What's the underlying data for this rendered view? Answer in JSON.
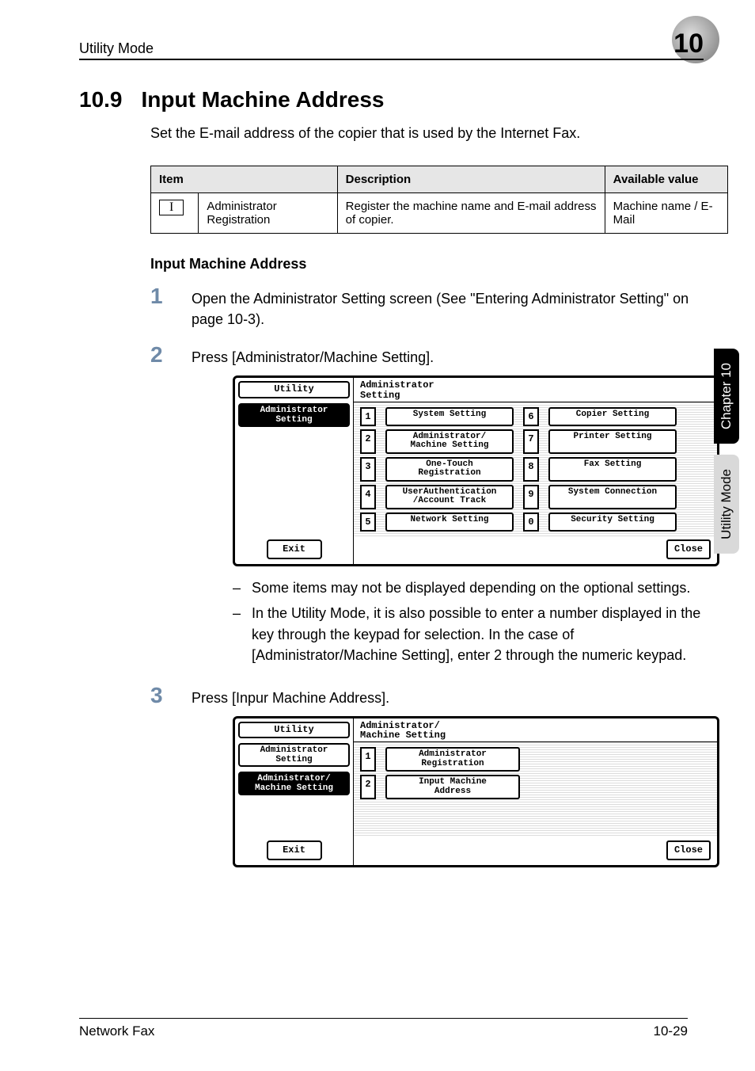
{
  "runhead": {
    "left": "Utility Mode",
    "right": "10"
  },
  "section": {
    "number": "10.9",
    "title": "Input Machine Address"
  },
  "intro": "Set the E-mail address of the copier that is used by the Internet Fax.",
  "table": {
    "headers": {
      "item": "Item",
      "desc": "Description",
      "avail": "Available value"
    },
    "row": {
      "roman": "I",
      "item": "Administrator Registration",
      "desc": "Register the machine name and E-mail address of copier.",
      "avail": "Machine name / E-Mail"
    }
  },
  "subheading": "Input Machine Address",
  "steps": {
    "s1": "Open the Administrator Setting screen (See \"Entering Administrator Setting\" on page 10-3).",
    "s2": "Press [Administrator/Machine Setting].",
    "s3": "Press [Inpur Machine Address]."
  },
  "lcd1": {
    "sidebar": {
      "utility": "Utility",
      "admin": "Administrator\nSetting"
    },
    "panelTitle": "Administrator\nSetting",
    "buttons": {
      "1": "System Setting",
      "2": "Administrator/\nMachine Setting",
      "3": "One-Touch\nRegistration",
      "4": "UserAuthentication\n/Account Track",
      "5": "Network Setting",
      "6": "Copier Setting",
      "7": "Printer Setting",
      "8": "Fax Setting",
      "9": "System Connection",
      "0": "Security Setting"
    },
    "exit": "Exit",
    "close": "Close"
  },
  "notes": {
    "n1": "Some items may not be displayed depending on the optional settings.",
    "n2": "In the Utility Mode, it is also possible to enter a number displayed in the key through the keypad for selection. In the case of [Administrator/Machine Setting], enter 2 through the numeric keypad."
  },
  "lcd2": {
    "sidebar": {
      "utility": "Utility",
      "admin": "Administrator\nSetting",
      "machine": "Administrator/\nMachine Setting"
    },
    "panelTitle": "Administrator/\nMachine Setting",
    "buttons": {
      "1": "Administrator\nRegistration",
      "2": "Input Machine\nAddress"
    },
    "exit": "Exit",
    "close": "Close"
  },
  "sidetabs": {
    "chapter": "Chapter 10",
    "mode": "Utility Mode"
  },
  "footer": {
    "left": "Network Fax",
    "right": "10-29"
  }
}
